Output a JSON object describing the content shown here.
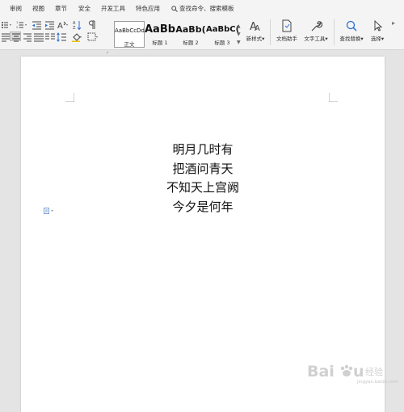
{
  "menu": {
    "items": [
      "审阅",
      "视图",
      "章节",
      "安全",
      "开发工具",
      "特色应用"
    ],
    "search_label": "查找命令、搜索模板"
  },
  "ribbon": {
    "styles": [
      {
        "preview": "AaBbCcDd",
        "label": "正文"
      },
      {
        "preview": "AaBb",
        "label": "标题 1"
      },
      {
        "preview": "AaBb(",
        "label": "标题 2"
      },
      {
        "preview": "AaBbC(",
        "label": "标题 3"
      }
    ],
    "tools": {
      "new_style": "新样式",
      "doc_assistant": "文档助手",
      "text_tools": "文字工具",
      "find_replace": "查找替换",
      "select": "选择"
    }
  },
  "document": {
    "lines": [
      "明月几时有",
      "把酒问青天",
      "不知天上宫阙",
      "今夕是何年"
    ]
  },
  "watermark": {
    "brand": "Baidu 经验",
    "url": "jingyan.baidu.com"
  },
  "colors": {
    "toolbar_bg": "#f4f4f4",
    "workspace_bg": "#e4e4e4",
    "page_bg": "#ffffff",
    "accent_blue": "#2d6fd6"
  }
}
